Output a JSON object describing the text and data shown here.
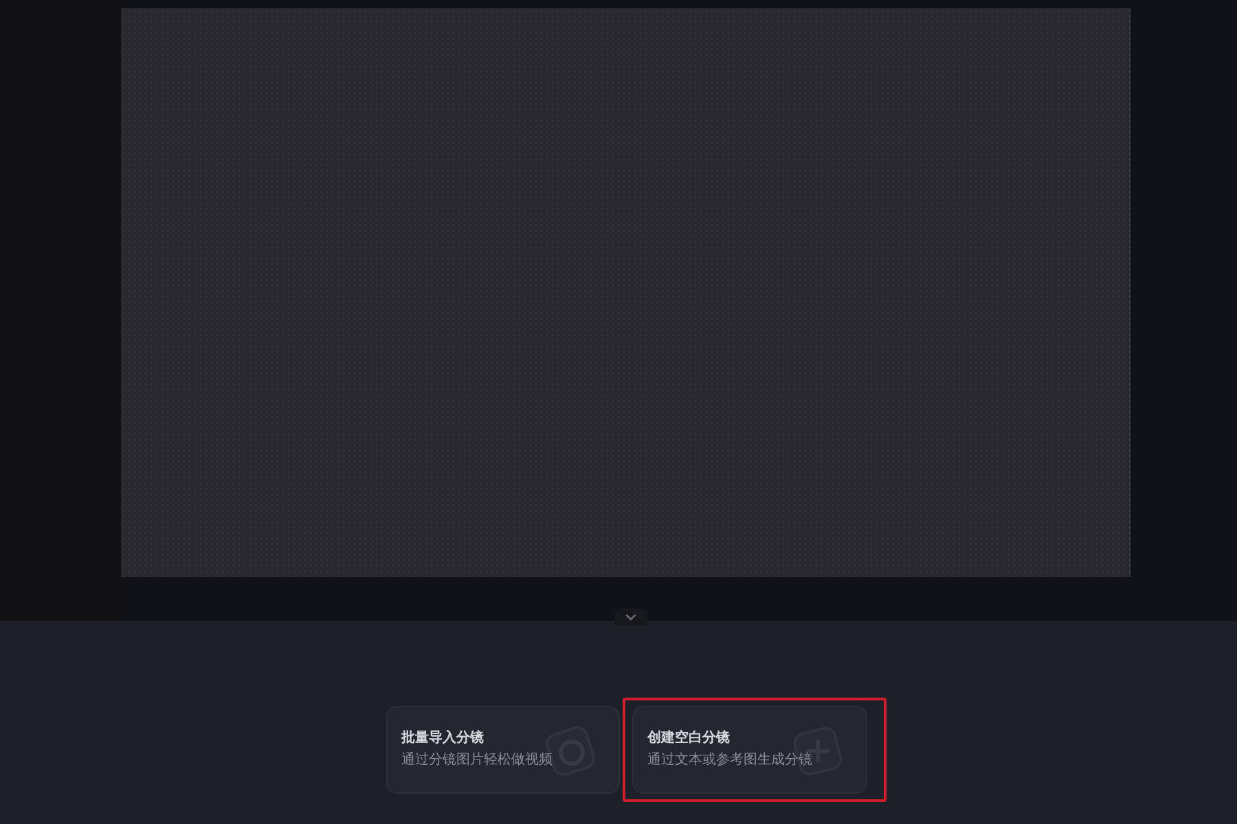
{
  "cards": [
    {
      "kind": "import",
      "title": "批量导入分镜",
      "description": "通过分镜图片轻松做视频",
      "highlighted": false
    },
    {
      "kind": "blank",
      "title": "创建空白分镜",
      "description": "通过文本或参考图生成分镜",
      "highlighted": true
    }
  ]
}
